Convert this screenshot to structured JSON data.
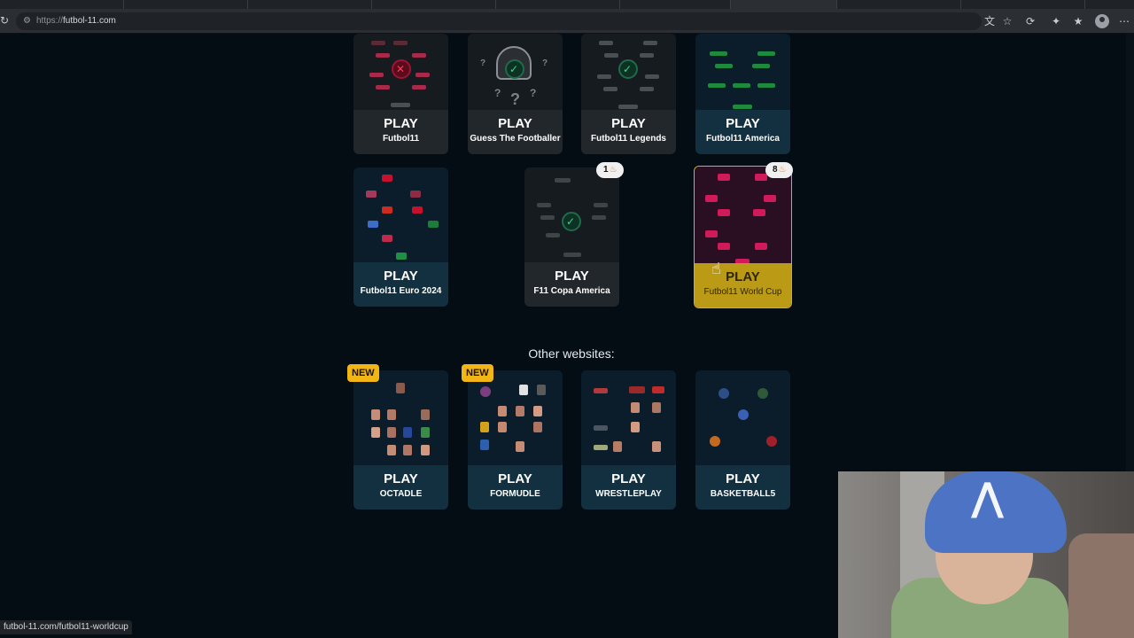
{
  "browser": {
    "url_scheme": "https://",
    "url_host": "futbol-11.com"
  },
  "top_games": [
    {
      "play": "PLAY",
      "name": "Futbol11"
    },
    {
      "play": "PLAY",
      "name": "Guess The Footballer"
    },
    {
      "play": "PLAY",
      "name": "Futbol11 Legends"
    },
    {
      "play": "PLAY",
      "name": "Futbol11 America"
    }
  ],
  "second_games": [
    {
      "play": "PLAY",
      "name": "Futbol11 Euro 2024"
    },
    {
      "play": "PLAY",
      "name": "F11 Copa America",
      "badge_count": "1"
    },
    {
      "play": "PLAY",
      "name": "Futbol11 World Cup",
      "badge_count": "8"
    }
  ],
  "other_websites": {
    "title": "Other websites:",
    "new_badge": "NEW",
    "items": [
      {
        "play": "PLAY",
        "name": "OCTADLE"
      },
      {
        "play": "PLAY",
        "name": "FORMUDLE"
      },
      {
        "play": "PLAY",
        "name": "WRESTLEPLAY"
      },
      {
        "play": "PLAY",
        "name": "BASKETBALL5"
      }
    ]
  },
  "status_bar": {
    "link": "futbol-11.com/futbol11-worldcup"
  },
  "colors": {
    "background": "#040d14",
    "gold_card": "#bb9a15",
    "check_green": "#27e08b",
    "new_badge": "#f2b516"
  }
}
